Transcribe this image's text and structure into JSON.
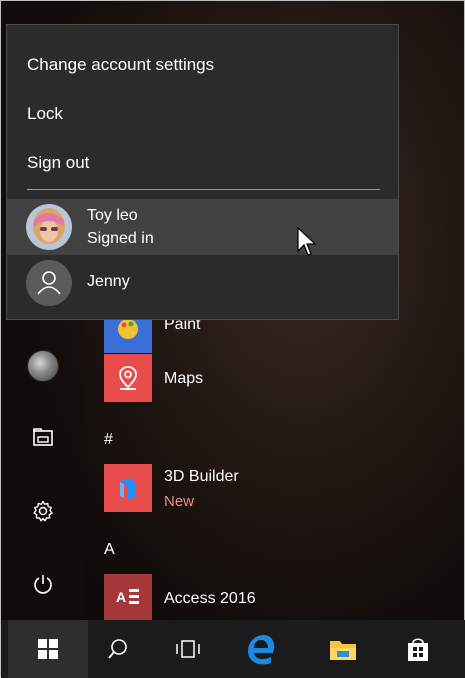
{
  "account_menu": {
    "items": [
      {
        "label": "Change account settings"
      },
      {
        "label": "Lock"
      },
      {
        "label": "Sign out"
      }
    ],
    "users": [
      {
        "name": "Toy leo",
        "status": "Signed in"
      },
      {
        "name": "Jenny"
      }
    ]
  },
  "apps": [
    {
      "label": "Paint",
      "tile_color": "#3a6fd8"
    },
    {
      "label": "Maps",
      "tile_color": "#e84c4c"
    },
    {
      "section": "#"
    },
    {
      "label": "3D Builder",
      "sub": "New",
      "tile_color": "#e84c4c"
    },
    {
      "section": "A"
    },
    {
      "label": "Access 2016",
      "tile_color": "#a4373a"
    }
  ],
  "left_rail": {
    "icons": [
      "user-avatar",
      "file-explorer-icon",
      "settings-gear-icon",
      "power-icon"
    ]
  },
  "taskbar": {
    "icons": [
      "windows-start-icon",
      "search-icon",
      "task-view-icon",
      "edge-icon",
      "file-explorer-icon",
      "store-icon"
    ]
  },
  "colors": {
    "menu_bg": "#2b2b2b",
    "hover_row": "#414141",
    "accent_red": "#e84c4c",
    "new_badge": "#f08a82",
    "edge_blue": "#1e88e5"
  }
}
